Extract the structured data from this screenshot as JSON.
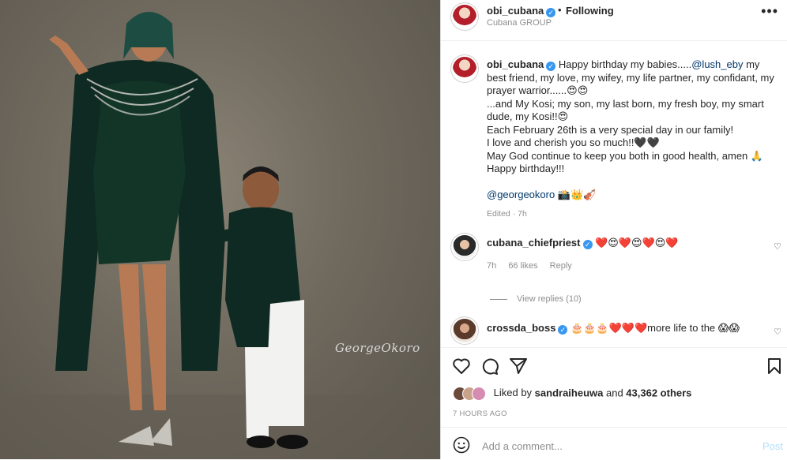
{
  "post": {
    "photo_alt": "Georgeokoro",
    "watermark": "GeorgeOkoro"
  },
  "header": {
    "username": "obi_cubana",
    "dot": "•",
    "following": "Following",
    "subtitle": "Cubana GROUP",
    "more": "•••"
  },
  "caption": {
    "username": "obi_cubana",
    "lines": [
      "Happy birthday my babies.....",
      "@lush_eby",
      " my best friend, my love, my wifey, my life partner, my confidant, my prayer warrior......😍😍",
      "...and My Kosi; my son, my last born, my fresh boy, my smart dude, my Kosi!!😍",
      "Each February 26th is a very special day in our family!",
      "I love and cherish you so much!!🖤🖤",
      "May God continue to keep you both in good health, amen 🙏",
      "Happy birthday!!!",
      "@georgeokoro",
      " 📸👑🎻"
    ],
    "edited": "Edited · 7h"
  },
  "comments": [
    {
      "username": "cubana_chiefpriest",
      "text": "❤️😍❤️😍❤️😍❤️",
      "time": "7h",
      "likes": "66 likes",
      "reply": "Reply",
      "view_replies": "View replies (10)"
    },
    {
      "username": "crossda_boss",
      "text": "🎂🎂🎂❤️❤️❤️more life to the 😱😱"
    }
  ],
  "likes": {
    "prefix": "Liked by ",
    "user": "sandraiheuwa",
    "middle": " and ",
    "others": "43,362 others"
  },
  "time_ago": "7 HOURS AGO",
  "add_comment": {
    "placeholder": "Add a comment...",
    "post": "Post"
  },
  "icons": {
    "like": "heart-icon",
    "comment": "comment-icon",
    "share": "paper-plane-icon",
    "save": "bookmark-icon",
    "emoji": "smiley-icon",
    "more": "more-options-icon",
    "verified": "verified-badge-icon"
  },
  "colors": {
    "verified": "#3897f0",
    "mention": "#00376b",
    "post_disabled": "#b2dffc",
    "muted": "#8e8e8e"
  }
}
